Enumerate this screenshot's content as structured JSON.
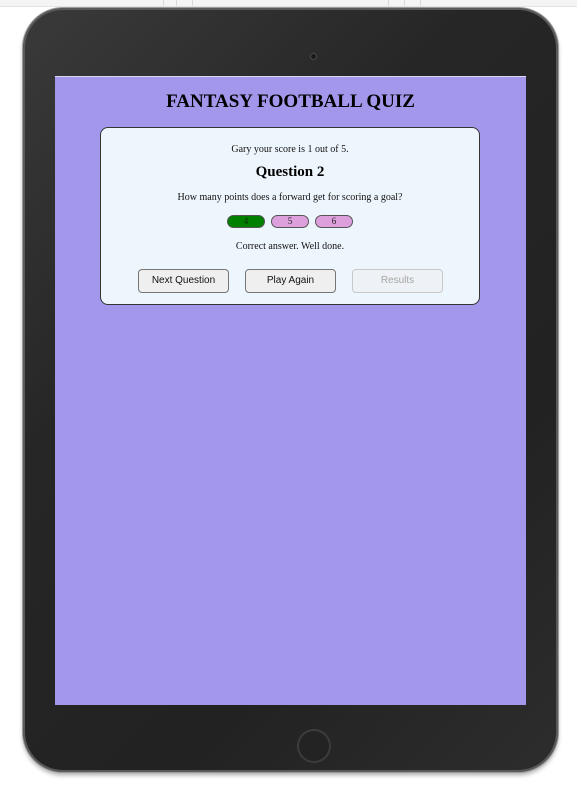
{
  "app": {
    "title": "FANTASY FOOTBALL QUIZ"
  },
  "quiz": {
    "score_text": "Gary your score is 1 out of 5.",
    "question_heading": "Question 2",
    "question_text": "How many points does a forward get for scoring a goal?",
    "answers": [
      {
        "label": "4",
        "state": "correct"
      },
      {
        "label": "5",
        "state": "default"
      },
      {
        "label": "6",
        "state": "default"
      }
    ],
    "feedback": "Correct answer. Well done."
  },
  "actions": {
    "next_label": "Next Question",
    "play_again_label": "Play Again",
    "results_label": "Results",
    "results_enabled": false
  },
  "colors": {
    "screen_background": "#a397ec",
    "card_background": "#eef6fd",
    "correct_answer": "#008000",
    "answer_option": "#dda0dd"
  }
}
